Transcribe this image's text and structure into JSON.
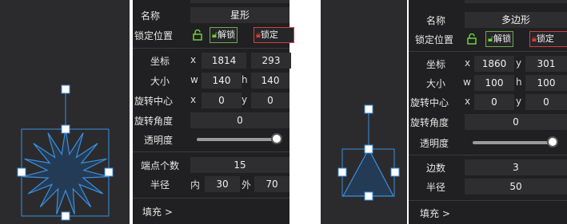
{
  "left": {
    "name_label": "名称",
    "name_value": "星形",
    "lock_label": "锁定位置",
    "unlock_label": "解锁",
    "lock_btn_label": "锁定",
    "coord_label": "坐标",
    "x_axis": "x",
    "y_axis": "y",
    "coord_x": "1814",
    "coord_y": "293",
    "size_label": "大小",
    "w_axis": "w",
    "h_axis": "h",
    "size_w": "140",
    "size_h": "140",
    "rotcenter_label": "旋转中心",
    "rot_x": "0",
    "rot_y": "0",
    "angle_label": "旋转角度",
    "angle_value": "0",
    "opacity_label": "透明度",
    "opacity_value": 1.0,
    "points_label": "端点个数",
    "points_value": "15",
    "radius_label": "半径",
    "inner_label": "内",
    "inner_value": "30",
    "outer_label": "外",
    "outer_value": "70",
    "fill_label": "填充 >"
  },
  "right": {
    "name_label": "名称",
    "name_value": "多边形",
    "lock_label": "锁定位置",
    "unlock_label": "解锁",
    "lock_btn_label": "锁定",
    "coord_label": "坐标",
    "x_axis": "x",
    "y_axis": "y",
    "coord_x": "1860",
    "coord_y": "301",
    "size_label": "大小",
    "w_axis": "w",
    "h_axis": "h",
    "size_w": "100",
    "size_h": "100",
    "rotcenter_label": "旋转中心",
    "rot_x": "0",
    "rot_y": "0",
    "angle_label": "旋转角度",
    "angle_value": "0",
    "opacity_label": "透明度",
    "opacity_value": 1.0,
    "sides_label": "边数",
    "sides_value": "3",
    "radius_label": "半径",
    "radius_value": "50",
    "fill_label": "填充 >"
  },
  "colors": {
    "shape_fill": "#243b55",
    "shape_stroke": "#3a8fe0",
    "lock_green": "#6fcf3a",
    "lock_red": "#e03a3a"
  }
}
